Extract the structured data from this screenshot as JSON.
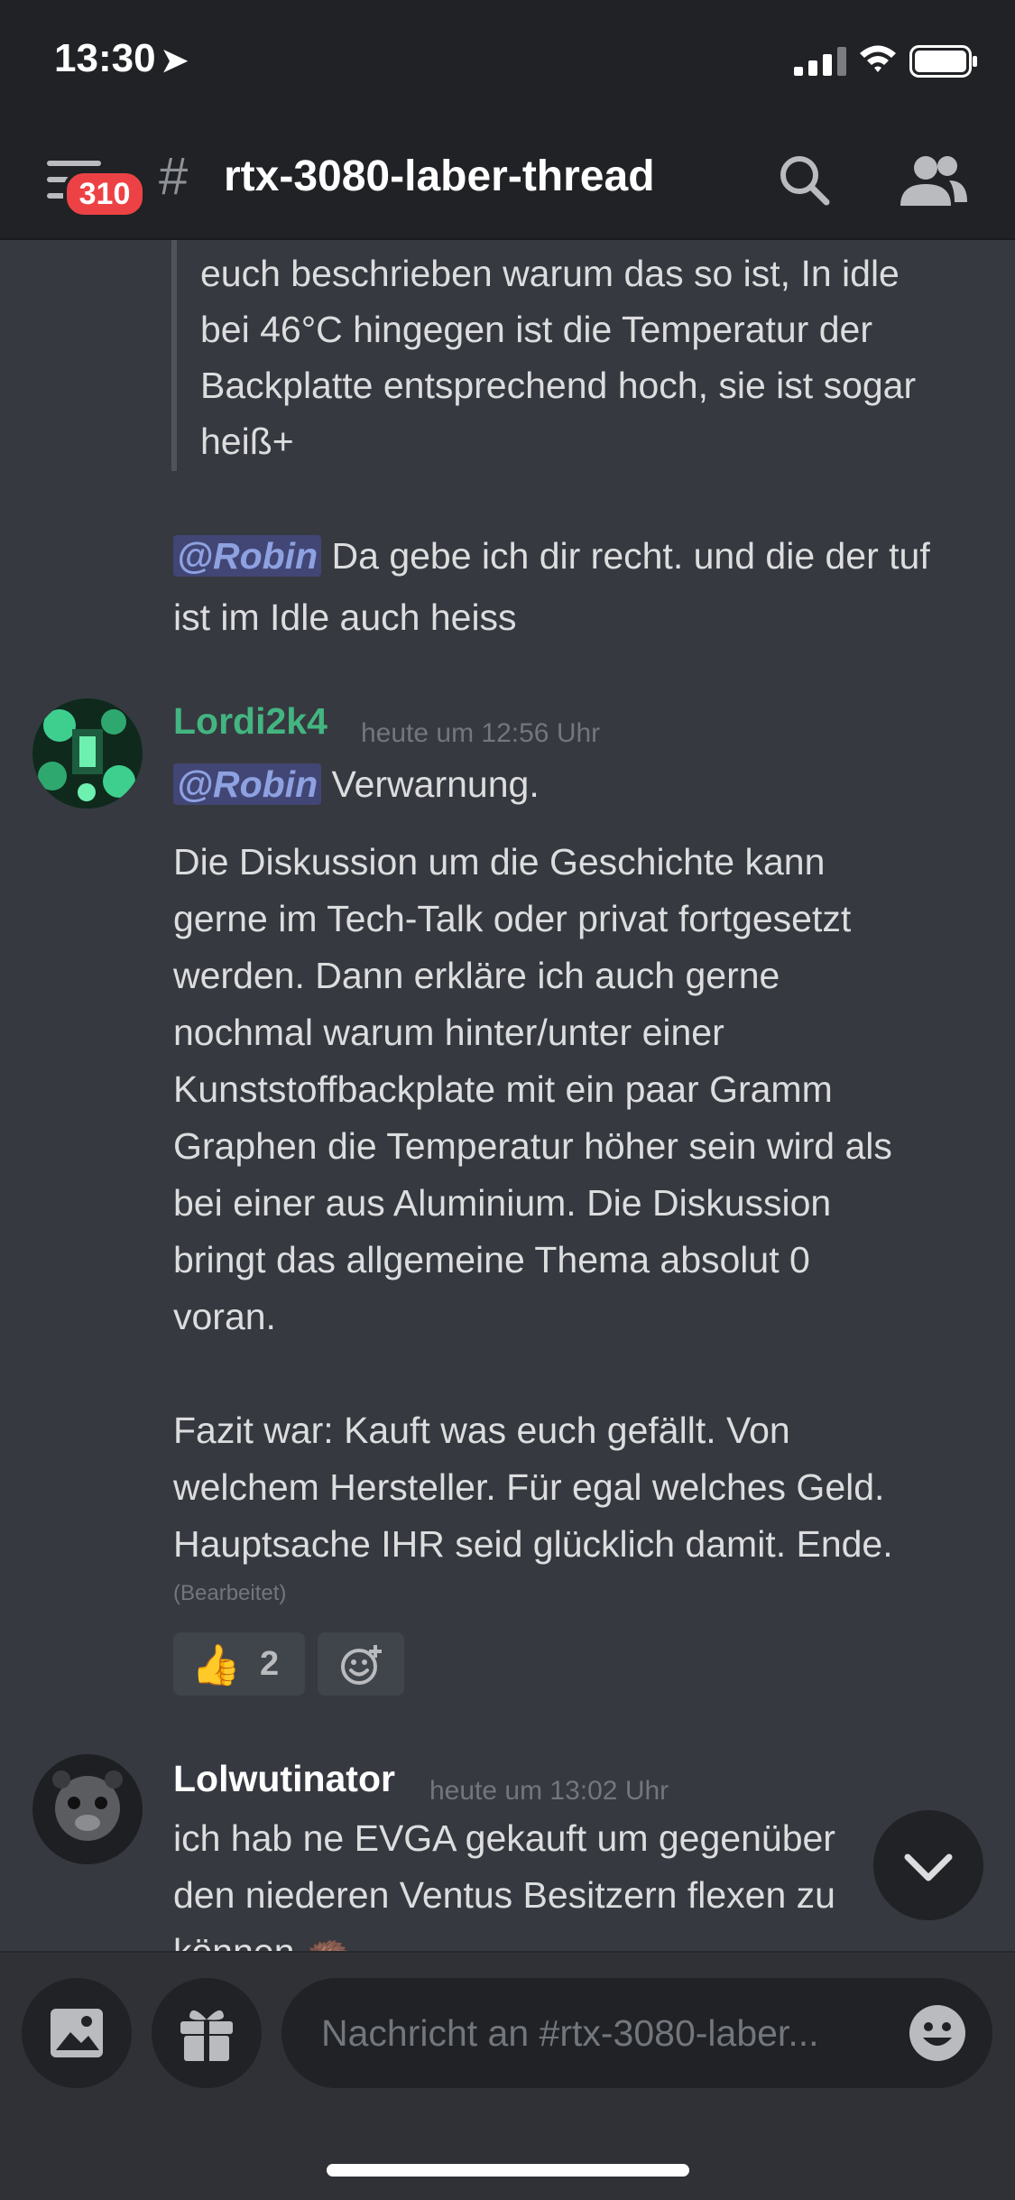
{
  "status_bar": {
    "time": "13:30",
    "location_glyph": "➤"
  },
  "header": {
    "unread_count": "310",
    "hash": "#",
    "channel_name": "rtx-3080-laber-thread"
  },
  "messages": {
    "quote_lines": [
      "euch beschrieben warum das so ist, In idle",
      "bei 46°C hingegen ist die Temperatur der",
      "Backplatte entsprechend hoch, sie ist sogar",
      "heiß+"
    ],
    "reply": {
      "mention": "@Robin",
      "text_a": " Da gebe ich dir recht. und die der tuf",
      "text_b": "ist im Idle auch heiss"
    },
    "msg2": {
      "author": "Lordi2k4",
      "author_color": "#43b581",
      "timestamp": "heute um 12:56 Uhr",
      "mention": "@Robin",
      "mention_tail": " Verwarnung.",
      "lines": [
        "Die Diskussion um die Geschichte kann",
        "gerne im Tech-Talk oder privat fortgesetzt",
        "werden. Dann erkläre ich auch gerne",
        "nochmal warum hinter/unter einer",
        "Kunststoffbackplate mit ein paar Gramm",
        "Graphen die Temperatur höher sein wird als",
        "bei einer aus Aluminium. Die Diskussion",
        "bringt  das allgemeine Thema absolut 0",
        "voran.",
        "",
        "Fazit war: Kauft was euch gefällt. Von",
        "welchem Hersteller. Für egal welches Geld.",
        "Hauptsache IHR seid glücklich damit. Ende."
      ],
      "edited": "(Bearbeitet)",
      "reaction": {
        "emoji": "👍",
        "count": "2"
      }
    },
    "msg3": {
      "author": "Lolwutinator",
      "timestamp": "heute um 13:02 Uhr",
      "lines": [
        "ich hab ne EVGA gekauft um gegenüber",
        "den niederen Ventus Besitzern flexen zu",
        "können 🦔"
      ]
    }
  },
  "composer": {
    "placeholder": "Nachricht an #rtx-3080-laber..."
  }
}
